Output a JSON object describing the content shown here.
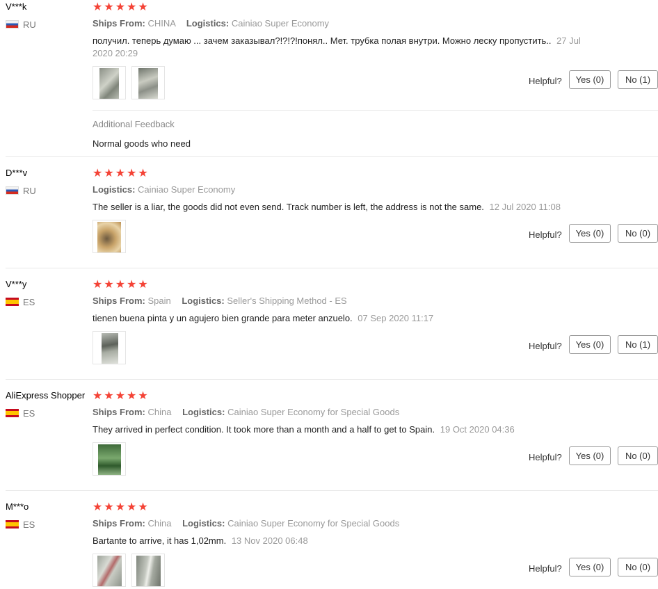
{
  "reviews": [
    {
      "user": "V***k",
      "country": "RU",
      "flag": "ru",
      "rating_label": "★★★★★",
      "ships_label": "Ships From:",
      "ships_from": "CHINA",
      "logistics_label": "Logistics:",
      "logistics": "Cainiao Super Economy",
      "text": "получил. теперь думаю ... зачем заказывал?!?!?!понял.. Мет. трубка полая внутри. Можно леску пропустить..",
      "date": "27 Jul 2020 20:29",
      "helpful_label": "Helpful?",
      "yes_label": "Yes (0)",
      "no_label": "No (1)",
      "additional_label": "Additional Feedback",
      "additional_text": "Normal goods who need"
    },
    {
      "user": "D***v",
      "country": "RU",
      "flag": "ru",
      "rating_label": "★★★★★",
      "logistics_label": "Logistics:",
      "logistics": "Cainiao Super Economy",
      "text": "The seller is a liar, the goods did not even send. Track number is left, the address is not the same.",
      "date": "12 Jul 2020 11:08",
      "helpful_label": "Helpful?",
      "yes_label": "Yes (0)",
      "no_label": "No (0)"
    },
    {
      "user": "V***y",
      "country": "ES",
      "flag": "es",
      "rating_label": "★★★★★",
      "ships_label": "Ships From:",
      "ships_from": "Spain",
      "logistics_label": "Logistics:",
      "logistics": "Seller's Shipping Method - ES",
      "text": "tienen buena pinta y un agujero bien grande para meter anzuelo.",
      "date": "07 Sep 2020 11:17",
      "helpful_label": "Helpful?",
      "yes_label": "Yes (0)",
      "no_label": "No (1)"
    },
    {
      "user": "AliExpress Shopper",
      "country": "ES",
      "flag": "es",
      "rating_label": "★★★★★",
      "ships_label": "Ships From:",
      "ships_from": "China",
      "logistics_label": "Logistics:",
      "logistics": "Cainiao Super Economy for Special Goods",
      "text": "They arrived in perfect condition. It took more than a month and a half to get to Spain.",
      "date": "19 Oct 2020 04:36",
      "helpful_label": "Helpful?",
      "yes_label": "Yes (0)",
      "no_label": "No (0)"
    },
    {
      "user": "M***o",
      "country": "ES",
      "flag": "es",
      "rating_label": "★★★★★",
      "ships_label": "Ships From:",
      "ships_from": "China",
      "logistics_label": "Logistics:",
      "logistics": "Cainiao Super Economy for Special Goods",
      "text": "Bartante to arrive, it has 1,02mm.",
      "date": "13 Nov 2020 06:48",
      "helpful_label": "Helpful?",
      "yes_label": "Yes (0)",
      "no_label": "No (0)"
    }
  ],
  "colors": {
    "star": "#f44336",
    "divider": "#e8e8e8",
    "muted": "#999999"
  }
}
